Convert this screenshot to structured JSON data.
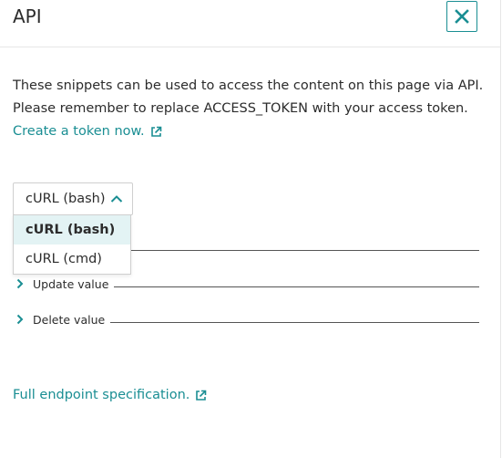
{
  "dialog": {
    "title": "API",
    "close_icon": "close-icon"
  },
  "intro": {
    "line1": "These snippets can be used to access the content on this page via API.",
    "line2": "Please remember to replace ACCESS_TOKEN with your access token.",
    "create_token_link": "Create a token now."
  },
  "snippet_select": {
    "value": "cURL (bash)",
    "expanded": true,
    "options": [
      {
        "label": "cURL (bash)",
        "selected": true
      },
      {
        "label": "cURL (cmd)",
        "selected": false
      }
    ]
  },
  "sections": [
    {
      "label": "Update value"
    },
    {
      "label": "Delete value"
    }
  ],
  "footer": {
    "spec_link": "Full endpoint specification."
  },
  "colors": {
    "accent": "#1a8e93",
    "selected_option_bg": "#e3f3f4",
    "border": "#cfcfcf"
  }
}
